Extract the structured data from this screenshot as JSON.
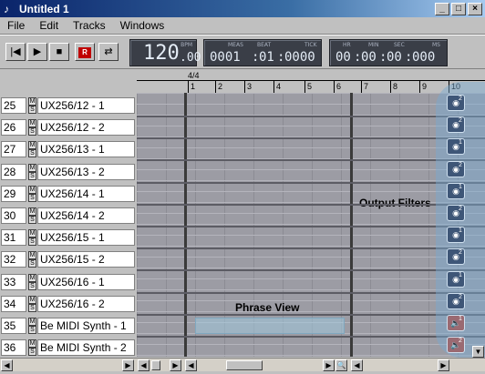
{
  "window": {
    "title": "Untitled 1"
  },
  "menu": {
    "items": [
      "File",
      "Edit",
      "Tracks",
      "Windows"
    ]
  },
  "transport": {
    "tempo": "120",
    "tempo_decimals": ".00",
    "tempo_label": "BPM",
    "meas": "0001",
    "beat": "01",
    "tick": "0000",
    "meas_label": "MEAS",
    "beat_label": "BEAT",
    "tick_label": "TICK",
    "hr": "00",
    "min": "00",
    "sec": "00",
    "ms": "000",
    "hr_label": "HR",
    "min_label": "MIN",
    "sec_label": "SEC",
    "ms_label": "MS"
  },
  "ruler": {
    "time_signature": "4/4",
    "measures": [
      "1",
      "2",
      "3",
      "4",
      "5",
      "6",
      "7",
      "8",
      "9",
      "10"
    ]
  },
  "tracks": [
    {
      "num": "25",
      "name": "UX256/12 - 1"
    },
    {
      "num": "26",
      "name": "UX256/12 - 2"
    },
    {
      "num": "27",
      "name": "UX256/13 - 1"
    },
    {
      "num": "28",
      "name": "UX256/13 - 2"
    },
    {
      "num": "29",
      "name": "UX256/14 - 1"
    },
    {
      "num": "30",
      "name": "UX256/14 - 2"
    },
    {
      "num": "31",
      "name": "UX256/15 - 1"
    },
    {
      "num": "32",
      "name": "UX256/15 - 2"
    },
    {
      "num": "33",
      "name": "UX256/16 - 1"
    },
    {
      "num": "34",
      "name": "UX256/16 - 2"
    },
    {
      "num": "35",
      "name": "Be MIDI Synth - 1"
    },
    {
      "num": "36",
      "name": "Be MIDI Synth - 2"
    }
  ],
  "labels": {
    "phrase_view": "Phrase View",
    "output_filters": "Output Filters",
    "mute": "M",
    "solo": "S"
  },
  "output_filters": [
    {
      "num": "2",
      "kind": "globe-icon"
    },
    {
      "num": "2",
      "kind": "globe-icon"
    },
    {
      "num": "1",
      "kind": "globe-icon"
    },
    {
      "num": "2",
      "kind": "globe-icon"
    },
    {
      "num": "1",
      "kind": "globe-icon"
    },
    {
      "num": "2",
      "kind": "globe-icon"
    },
    {
      "num": "1",
      "kind": "globe-icon"
    },
    {
      "num": "2",
      "kind": "globe-icon"
    },
    {
      "num": "1",
      "kind": "globe-icon"
    },
    {
      "num": "2",
      "kind": "globe-icon"
    },
    {
      "num": "1",
      "kind": "speaker-icon"
    },
    {
      "num": "2",
      "kind": "speaker-icon"
    }
  ]
}
